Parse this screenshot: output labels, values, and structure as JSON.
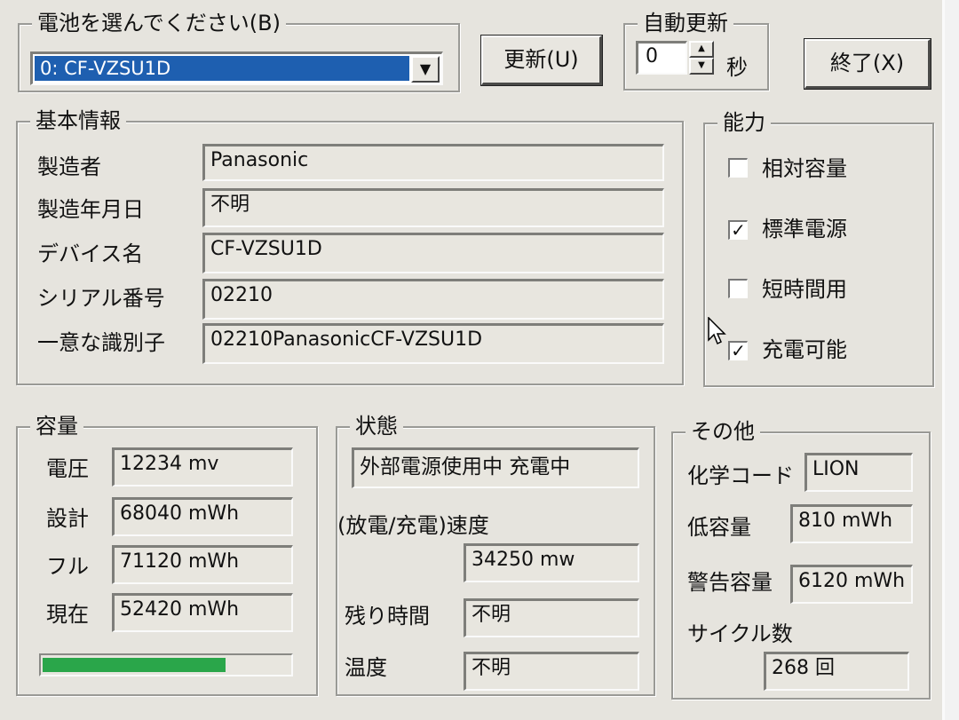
{
  "battery_select": {
    "legend": "電池を選んでください(B)",
    "selected": "0: CF-VZSU1D"
  },
  "buttons": {
    "refresh": "更新(U)",
    "exit": "終了(X)"
  },
  "auto_refresh": {
    "legend": "自動更新",
    "value": "0",
    "unit": "秒"
  },
  "basic_info": {
    "legend": "基本情報",
    "rows": [
      {
        "label": "製造者",
        "value": "Panasonic"
      },
      {
        "label": "製造年月日",
        "value": "不明"
      },
      {
        "label": "デバイス名",
        "value": "CF-VZSU1D"
      },
      {
        "label": "シリアル番号",
        "value": "02210"
      },
      {
        "label": "一意な識別子",
        "value": "02210PanasonicCF-VZSU1D"
      }
    ]
  },
  "capability": {
    "legend": "能力",
    "items": [
      {
        "label": "相対容量",
        "checked": false,
        "mark": ""
      },
      {
        "label": "標準電源",
        "checked": true,
        "mark": "✓"
      },
      {
        "label": "短時間用",
        "checked": false,
        "mark": ""
      },
      {
        "label": "充電可能",
        "checked": true,
        "mark": "✓"
      }
    ]
  },
  "capacity": {
    "legend": "容量",
    "rows": [
      {
        "label": "電圧",
        "value": "12234 mv"
      },
      {
        "label": "設計",
        "value": "68040 mWh"
      },
      {
        "label": "フル",
        "value": "71120 mWh"
      },
      {
        "label": "現在",
        "value": "52420 mWh"
      }
    ],
    "charge_fraction": 0.74,
    "bar_color": "#2aa64a"
  },
  "status": {
    "legend": "状態",
    "state": "外部電源使用中 充電中",
    "rate_label": "(放電/充電)速度",
    "rate_value": "34250 mw",
    "remaining_label": "残り時間",
    "remaining_value": "不明",
    "temp_label": "温度",
    "temp_value": "不明"
  },
  "other": {
    "legend": "その他",
    "chem_label": "化学コード",
    "chem_value": "LION",
    "low_label": "低容量",
    "low_value": "810 mWh",
    "warn_label": "警告容量",
    "warn_value": "6120 mWh",
    "cycle_label": "サイクル数",
    "cycle_value": "268 回"
  }
}
